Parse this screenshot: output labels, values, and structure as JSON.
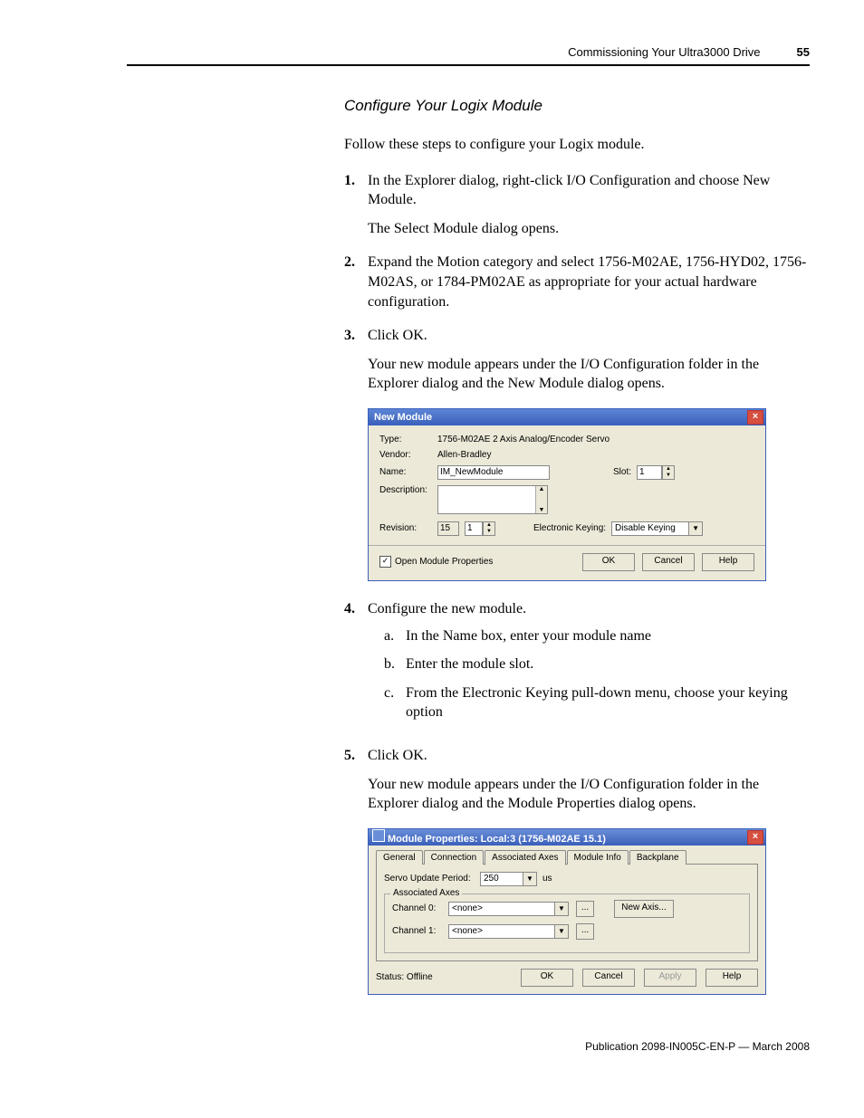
{
  "header": {
    "running": "Commissioning Your Ultra3000 Drive",
    "page": "55"
  },
  "section_title": "Configure Your Logix Module",
  "intro": "Follow these steps to configure your Logix module.",
  "steps": [
    {
      "num": "1.",
      "text": "In the Explorer dialog, right-click I/O Configuration and choose New Module.",
      "after": "The Select Module dialog opens."
    },
    {
      "num": "2.",
      "text": "Expand the Motion category and select 1756-M02AE, 1756-HYD02, 1756-M02AS, or 1784-PM02AE as appropriate for your actual hardware configuration."
    },
    {
      "num": "3.",
      "text": "Click OK.",
      "after": "Your new module appears under the I/O Configuration folder in the Explorer dialog and the New Module dialog opens."
    },
    {
      "num": "4.",
      "text": "Configure the new module.",
      "sub": [
        {
          "l": "a.",
          "t": "In the Name box, enter your module name"
        },
        {
          "l": "b.",
          "t": "Enter the module slot."
        },
        {
          "l": "c.",
          "t": "From the Electronic Keying pull-down menu, choose your keying option"
        }
      ]
    },
    {
      "num": "5.",
      "text": "Click OK.",
      "after": "Your new module appears under the I/O Configuration folder in the Explorer dialog and the Module Properties dialog opens."
    }
  ],
  "dlg1": {
    "title": "New Module",
    "labels": {
      "type": "Type:",
      "vendor": "Vendor:",
      "name": "Name:",
      "desc": "Description:",
      "slot": "Slot:",
      "rev": "Revision:",
      "ek": "Electronic Keying:"
    },
    "values": {
      "type": "1756-M02AE 2 Axis Analog/Encoder Servo",
      "vendor": "Allen-Bradley",
      "name": "IM_NewModule",
      "slot": "1",
      "rev_major": "15",
      "rev_minor": "1",
      "ek": "Disable Keying"
    },
    "checkbox": "Open Module Properties",
    "buttons": {
      "ok": "OK",
      "cancel": "Cancel",
      "help": "Help"
    }
  },
  "dlg2": {
    "title": "Module Properties: Local:3 (1756-M02AE 15.1)",
    "tabs": [
      "General",
      "Connection",
      "Associated Axes",
      "Module Info",
      "Backplane"
    ],
    "active_tab": 2,
    "servo_label": "Servo Update Period:",
    "servo_value": "250",
    "servo_unit": "us",
    "group": "Associated Axes",
    "ch0_label": "Channel 0:",
    "ch1_label": "Channel 1:",
    "none": "<none>",
    "new_axis": "New Axis...",
    "status_label": "Status:",
    "status_value": "Offline",
    "buttons": {
      "ok": "OK",
      "cancel": "Cancel",
      "apply": "Apply",
      "help": "Help"
    }
  },
  "footer": "Publication 2098-IN005C-EN-P — March 2008"
}
